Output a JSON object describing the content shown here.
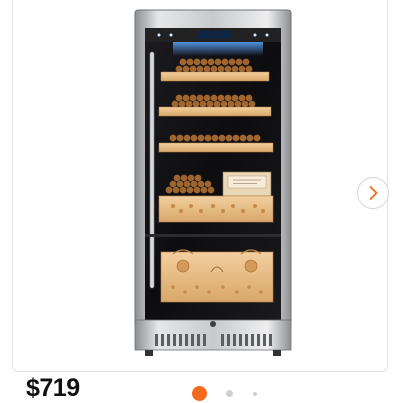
{
  "product": {
    "image_alt": "",
    "display_readout": "",
    "price": "$719"
  },
  "gallery": {
    "total_images": 3,
    "active_index": 0,
    "next_icon": "chevron-right-icon"
  },
  "colors": {
    "accent": "#f26a1b",
    "inactive_dot": "#cfcfcf",
    "display_glow": "#5aa9ff"
  }
}
